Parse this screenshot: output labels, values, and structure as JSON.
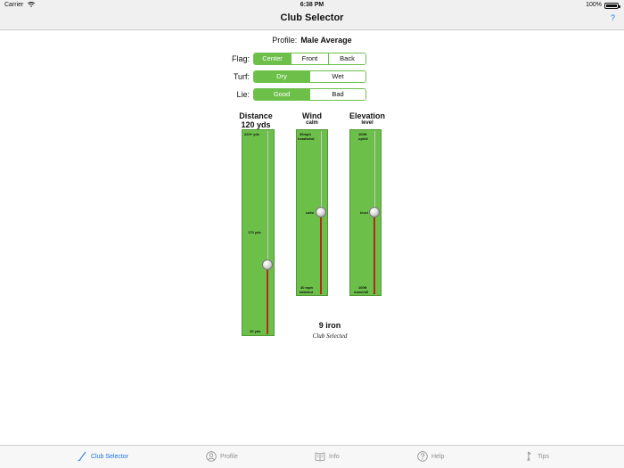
{
  "status_bar": {
    "carrier": "Carrier",
    "time": "6:38 PM",
    "battery": "100%"
  },
  "nav": {
    "title": "Club Selector",
    "help": "?"
  },
  "profile": {
    "label": "Profile:",
    "value": "Male Average"
  },
  "controls": {
    "flag": {
      "label": "Flag:",
      "options": [
        "Center",
        "Front",
        "Back"
      ],
      "selected": "Center"
    },
    "turf": {
      "label": "Turf:",
      "options": [
        "Dry",
        "Wet"
      ],
      "selected": "Dry"
    },
    "lie": {
      "label": "Lie:",
      "options": [
        "Good",
        "Bad"
      ],
      "selected": "Good"
    }
  },
  "sliders": {
    "distance": {
      "title": "Distance",
      "value_text": "120 yds",
      "top_label": "320+ yds",
      "mid_label": "170 yds",
      "bottom_label": "20 yds",
      "value_fraction": 0.33
    },
    "wind": {
      "title": "Wind",
      "value_text": "calm",
      "top_label_1": "30mph",
      "top_label_2": "headwind",
      "mid_label": "calm",
      "bottom_label_1": "30 mph",
      "bottom_label_2": "tailwind",
      "value_fraction": 0.5
    },
    "elevation": {
      "title": "Elevation",
      "value_text": "level",
      "top_label_1": "100ft",
      "top_label_2": "uphill",
      "mid_label": "level",
      "bottom_label_1": "100ft",
      "bottom_label_2": "downhill",
      "value_fraction": 0.5
    }
  },
  "result": {
    "club": "9 iron",
    "caption": "Club Selected"
  },
  "tabs": [
    {
      "label": "Club Selector",
      "icon": "golf-club-icon",
      "active": true
    },
    {
      "label": "Profile",
      "icon": "person-icon",
      "active": false
    },
    {
      "label": "Info",
      "icon": "book-icon",
      "active": false
    },
    {
      "label": "Help",
      "icon": "question-circle-icon",
      "active": false
    },
    {
      "label": "Tips",
      "icon": "golfer-icon",
      "active": false
    }
  ],
  "colors": {
    "accent_green": "#6cc04a",
    "tint_blue": "#1a73e8",
    "rail_red": "#b22a1a"
  }
}
